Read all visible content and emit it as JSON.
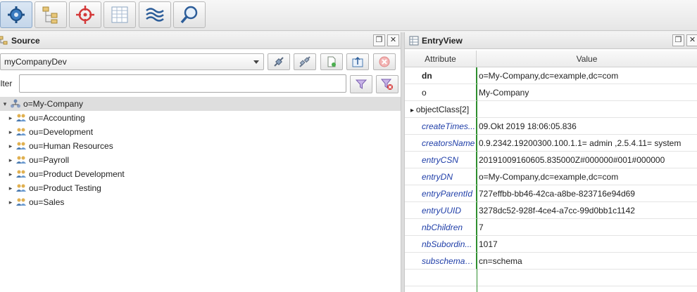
{
  "toolbar": {
    "buttons": [
      {
        "name": "settings",
        "icon": "gear-icon",
        "active": true
      },
      {
        "name": "tree-view",
        "icon": "tree-icon",
        "active": false
      },
      {
        "name": "target",
        "icon": "crosshair-icon",
        "active": false
      },
      {
        "name": "table-view",
        "icon": "grid-icon",
        "active": false
      },
      {
        "name": "waves",
        "icon": "waves-icon",
        "active": false
      },
      {
        "name": "search",
        "icon": "magnifier-icon",
        "active": false
      }
    ]
  },
  "source": {
    "title": "Source",
    "connection": "myCompanyDev",
    "filter_label": "ilter",
    "filter_value": "",
    "tree": {
      "root": "o=My-Company",
      "children": [
        "ou=Accounting",
        "ou=Development",
        "ou=Human Resources",
        "ou=Payroll",
        "ou=Product Development",
        "ou=Product Testing",
        "ou=Sales"
      ]
    }
  },
  "entry": {
    "title": "EntryView",
    "columns": {
      "attribute": "Attribute",
      "value": "Value"
    },
    "rows": [
      {
        "attr": "dn",
        "value": "o=My-Company,dc=example,dc=com",
        "style": "bold"
      },
      {
        "attr": "o",
        "value": "My-Company",
        "style": "normal"
      },
      {
        "attr": "objectClass[2]",
        "value": "",
        "style": "expandable"
      },
      {
        "attr": "createTimes...",
        "value": "09.Okt 2019 18:06:05.836",
        "style": "operational"
      },
      {
        "attr": "creatorsName",
        "value": "0.9.2342.19200300.100.1.1= admin ,2.5.4.11= system",
        "style": "operational"
      },
      {
        "attr": "entryCSN",
        "value": "20191009160605.835000Z#000000#001#000000",
        "style": "operational"
      },
      {
        "attr": "entryDN",
        "value": "o=My-Company,dc=example,dc=com",
        "style": "operational"
      },
      {
        "attr": "entryParentId",
        "value": "727effbb-bb46-42ca-a8be-823716e94d69",
        "style": "operational"
      },
      {
        "attr": "entryUUID",
        "value": "3278dc52-928f-4ce4-a7cc-99d0bb1c1142",
        "style": "operational"
      },
      {
        "attr": "nbChildren",
        "value": "7",
        "style": "operational"
      },
      {
        "attr": "nbSubordin...",
        "value": "1017",
        "style": "operational"
      },
      {
        "attr": "subschemaS...",
        "value": "cn=schema",
        "style": "operational"
      }
    ]
  }
}
